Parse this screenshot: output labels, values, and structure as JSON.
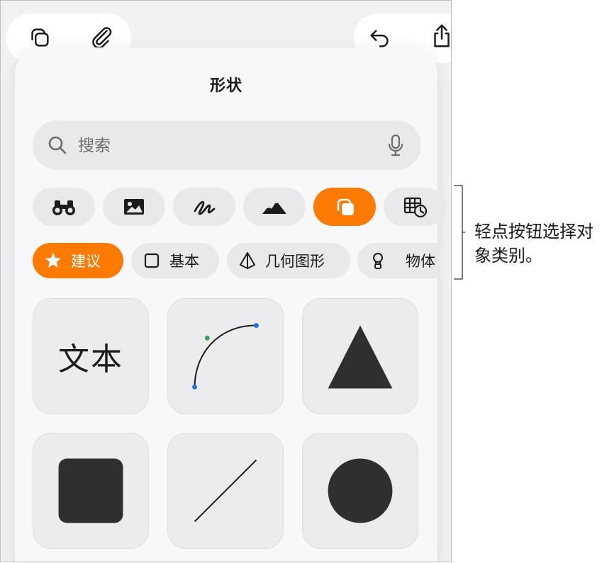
{
  "toolbar": {
    "left_buttons": [
      "shapes-icon",
      "paperclip-icon"
    ],
    "right_buttons": [
      "undo-icon",
      "share-icon"
    ]
  },
  "popover": {
    "title": "形状",
    "search": {
      "placeholder": "搜索",
      "value": ""
    },
    "categories": [
      {
        "icon": "binoculars-icon",
        "active": false
      },
      {
        "icon": "image-icon",
        "active": false
      },
      {
        "icon": "drawing-icon",
        "active": false
      },
      {
        "icon": "mountains-icon",
        "active": false
      },
      {
        "icon": "shapes-icon",
        "active": true
      },
      {
        "icon": "chart-table-icon",
        "active": false
      }
    ],
    "chips": [
      {
        "label": "建议",
        "icon": "star-icon",
        "active": true
      },
      {
        "label": "基本",
        "icon": "square-outline-icon",
        "active": false
      },
      {
        "label": "几何图形",
        "icon": "pyramid-icon",
        "active": false
      },
      {
        "label": "物体",
        "icon": "lightbulb-icon",
        "active": false
      }
    ],
    "tiles": [
      {
        "kind": "text",
        "label": "文本"
      },
      {
        "kind": "curve"
      },
      {
        "kind": "triangle"
      },
      {
        "kind": "square"
      },
      {
        "kind": "line"
      },
      {
        "kind": "circle"
      }
    ]
  },
  "callout": {
    "text": "轻点按钮选择对象类别。"
  },
  "colors": {
    "accent": "#ff7a00",
    "shape_fill": "#2f2f2f",
    "handle_blue": "#1a73e8",
    "handle_green": "#34a853"
  }
}
